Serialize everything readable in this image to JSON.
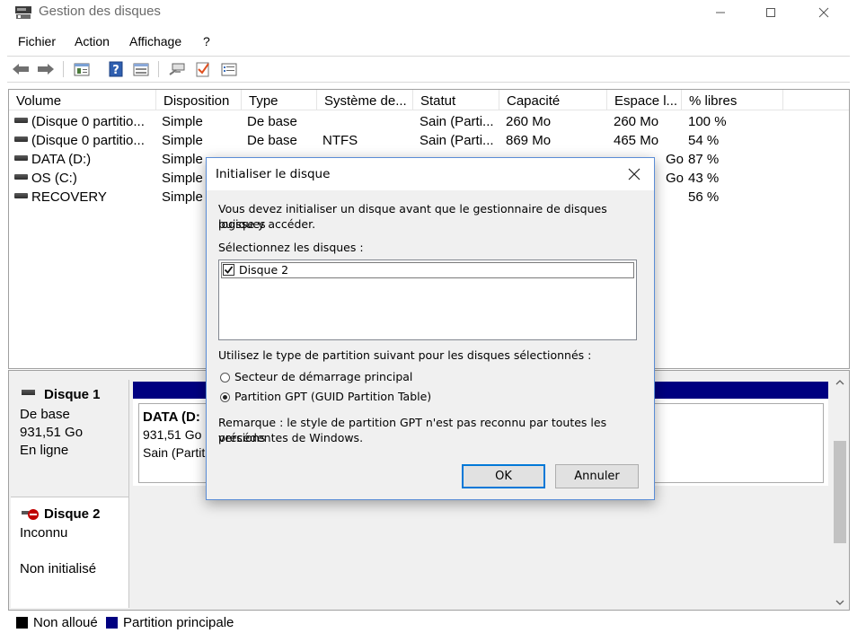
{
  "window": {
    "title": "Gestion des disques",
    "controls": [
      "minimize",
      "maximize",
      "close"
    ]
  },
  "menu": {
    "items": [
      "Fichier",
      "Action",
      "Affichage",
      "?"
    ]
  },
  "toolbar": {
    "icons": [
      "back-arrow-icon",
      "forward-arrow-icon",
      "properties-icon",
      "help-icon",
      "view-icon",
      "connect-icon",
      "check-icon",
      "list-icon"
    ]
  },
  "volume_list": {
    "columns": [
      "Volume",
      "Disposition",
      "Type",
      "Système de...",
      "Statut",
      "Capacité",
      "Espace l...",
      "% libres"
    ],
    "rows": [
      [
        "(Disque 0 partitio...",
        "Simple",
        "De base",
        "",
        "Sain (Parti...",
        "260 Mo",
        "260 Mo",
        "100 %"
      ],
      [
        "(Disque 0 partitio...",
        "Simple",
        "De base",
        "NTFS",
        "Sain (Parti...",
        "869 Mo",
        "465 Mo",
        "54 %"
      ],
      [
        "DATA (D:)",
        "Simple",
        "",
        "",
        "",
        "",
        "Go",
        "87 %"
      ],
      [
        "OS (C:)",
        "Simple",
        "",
        "",
        "",
        "",
        "Go",
        "43 %"
      ],
      [
        "RECOVERY",
        "Simple",
        "",
        "",
        "",
        "",
        "",
        "56 %"
      ]
    ]
  },
  "disks": {
    "disk1": {
      "name": "Disque 1",
      "type": "De base",
      "size": "931,51 Go",
      "status": "En ligne",
      "partition": {
        "label": "DATA (D:",
        "size": "931,51 Go",
        "status": "Sain (Partit"
      }
    },
    "disk2": {
      "name": "Disque 2",
      "type": "Inconnu",
      "status": "Non initialisé"
    }
  },
  "legend": {
    "items": [
      {
        "label": "Non alloué",
        "color": "#000000"
      },
      {
        "label": "Partition principale",
        "color": "#000080"
      }
    ]
  },
  "dialog": {
    "title": "Initialiser le disque",
    "intro_line1": "Vous devez initialiser un disque avant que le gestionnaire de disques logiques",
    "intro_line2": "puisse y accéder.",
    "select_label": "Sélectionnez les disques :",
    "disk_items": [
      {
        "label": "Disque 2",
        "checked": true
      }
    ],
    "partition_label": "Utilisez le type de partition suivant pour les disques sélectionnés :",
    "options": [
      {
        "label": "Secteur de démarrage principal",
        "selected": false
      },
      {
        "label": "Partition GPT (GUID Partition Table)",
        "selected": true
      }
    ],
    "note_line1": "Remarque : le style de partition GPT n'est pas reconnu par toutes les versions",
    "note_line2": "précédentes de Windows.",
    "ok_label": "OK",
    "cancel_label": "Annuler"
  },
  "colors": {
    "primary_partition": "#000080",
    "unallocated": "#000000",
    "focus": "#0078d7"
  }
}
